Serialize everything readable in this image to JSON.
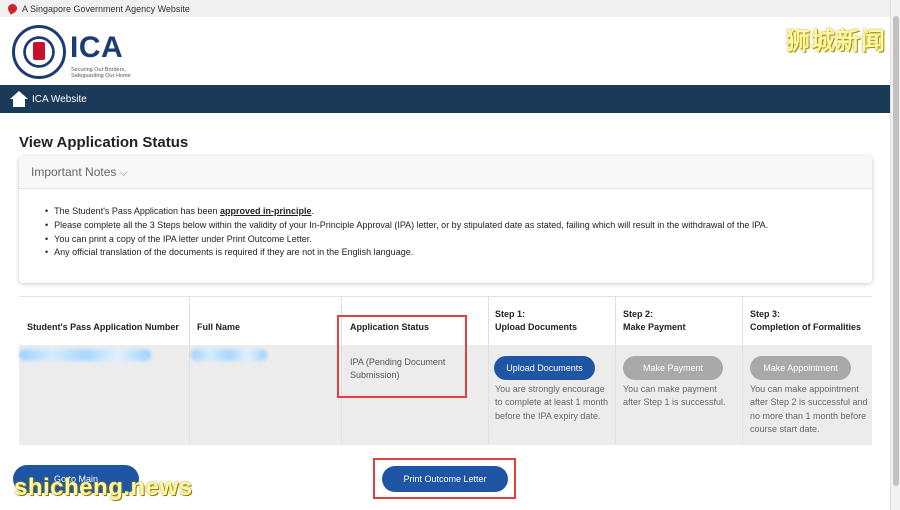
{
  "gov_bar": {
    "text": "A Singapore Government Agency Website"
  },
  "brand": {
    "name": "ICA",
    "tagline": "Securing Our Borders, Safeguarding Our Home"
  },
  "watermark_top": "狮城新闻",
  "nav": {
    "home_label": "ICA Website"
  },
  "page": {
    "title": "View Application Status"
  },
  "notes": {
    "header": "Important Notes",
    "item1_prefix": "The Student's Pass Application has been ",
    "item1_emphasis": "approved in-principle",
    "item1_suffix": ".",
    "item2": "Please complete all the 3 Steps below within the validity of your In-Principle Approval (IPA) letter, or by stipulated date as stated, failing which will result in the withdrawal of the IPA.",
    "item3": "You can print a copy of the IPA letter under Print Outcome Letter.",
    "item4": "Any official translation of the documents is required if they are not in the English language."
  },
  "table": {
    "col_app_number": "Student's Pass Application Number",
    "col_full_name": "Full Name",
    "col_status": "Application Status",
    "col_step1_line1": "Step 1:",
    "col_step1_line2": "Upload Documents",
    "col_step2_line1": "Step 2:",
    "col_step2_line2": "Make Payment",
    "col_step3_line1": "Step 3:",
    "col_step3_line2": "Completion of Formalities",
    "row": {
      "status": "IPA (Pending Document Submission)",
      "step1_button": "Upload Documents",
      "step1_desc": "You are strongly encourage to complete at least 1 month before the IPA expiry date.",
      "step2_button": "Make Payment",
      "step2_desc": "You can make payment after Step 1 is successful.",
      "step3_button": "Make Appointment",
      "step3_desc": "You can make appointment after Step 2 is successful and no more than 1 month before course start date."
    }
  },
  "footer": {
    "go_main": "Go to Main",
    "print": "Print Outcome Letter"
  },
  "watermark_bottom": "shicheng.news",
  "colors": {
    "primary_blue": "#1e56a5",
    "navbar": "#1b3a57",
    "highlight": "#e04040",
    "disabled": "#a9a9a9"
  }
}
